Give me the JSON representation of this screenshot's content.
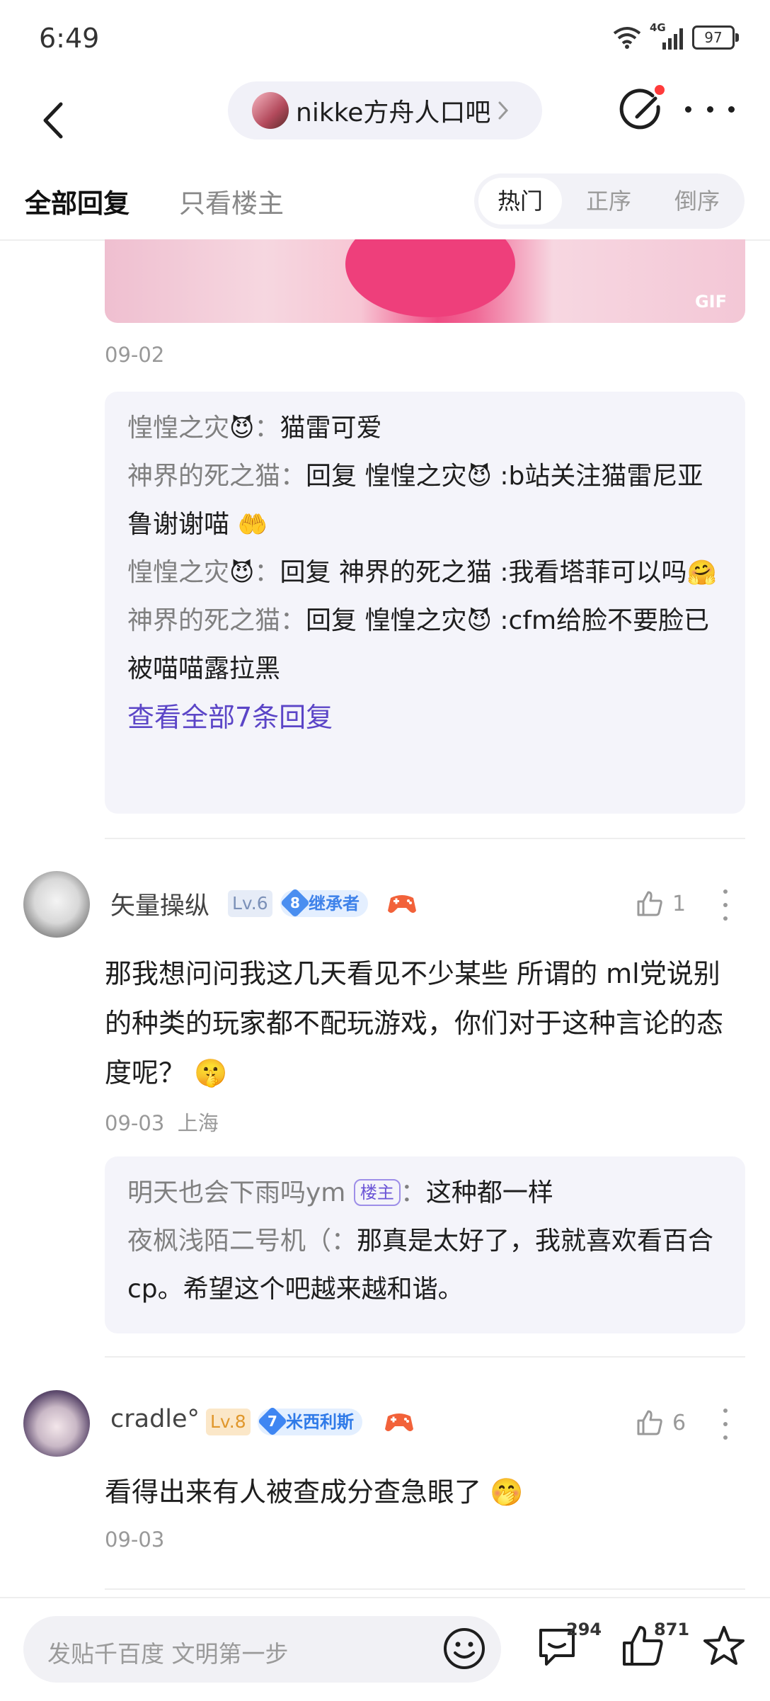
{
  "status": {
    "time": "6:49",
    "battery": "97",
    "network": "4G"
  },
  "nav": {
    "forum_name": "nikke方舟人口吧"
  },
  "tabs": {
    "all": "全部回复",
    "op_only": "只看楼主",
    "sort_hot": "热门",
    "sort_asc": "正序",
    "sort_desc": "倒序"
  },
  "gif_badge": "GIF",
  "first_comment": {
    "date": "09-02",
    "replies": [
      {
        "name": "惶惶之灾",
        "emoji": "😈",
        "sep": "：",
        "text": "猫雷可爱"
      },
      {
        "name": "神界的死之猫",
        "sep": "：",
        "prefix": "回复 ",
        "target": "惶惶之灾",
        "target_emoji": "😈",
        "text": " :b站关注猫雷尼亚鲁谢谢喵",
        "trail_emoji": "🤲"
      },
      {
        "name": "惶惶之灾",
        "emoji": "😈",
        "sep": "：",
        "prefix": "回复 ",
        "target": "神界的死之猫",
        "text": " :我看塔菲可以吗",
        "trail_emoji": "🤗"
      },
      {
        "name": "神界的死之猫",
        "sep": "：",
        "prefix": "回复 ",
        "target": "惶惶之灾",
        "target_emoji": "😈",
        "text": " :cfm给脸不要脸已被喵喵露拉黑"
      }
    ],
    "view_all": "查看全部7条回复"
  },
  "comments": [
    {
      "username": "矢量操纵",
      "level": "Lv.6",
      "badge_num": "8",
      "badge_label": "继承者",
      "badge_color": "#4a8ef0",
      "likes": "1",
      "text": "那我想问问我这几天看见不少某些 所谓的 ml党说别的种类的玩家都不配玩游戏，你们对于这种言论的态度呢？ 🤫",
      "date": "09-03",
      "location": "上海",
      "replies": [
        {
          "name": "明天也会下雨吗ym",
          "badge": "楼主",
          "sep": "：",
          "text": "这种都一样"
        },
        {
          "name": "夜枫浅陌二号机（",
          "sep": "：",
          "text": "那真是太好了，我就喜欢看百合cp。希望这个吧越来越和谐。"
        }
      ]
    },
    {
      "username": "cradle°",
      "level": "Lv.8",
      "badge_num": "7",
      "badge_label": "米西利斯",
      "badge_color": "#3f86f2",
      "likes": "6",
      "text": "看得出来有人被查成分查急眼了 🤭",
      "date": "09-03"
    }
  ],
  "bottom": {
    "placeholder": "发贴千百度 文明第一步",
    "comments_count": "294",
    "likes_count": "871"
  },
  "colors": {
    "accent": "#5b45c7",
    "reply_bg": "#f4f4fa"
  }
}
